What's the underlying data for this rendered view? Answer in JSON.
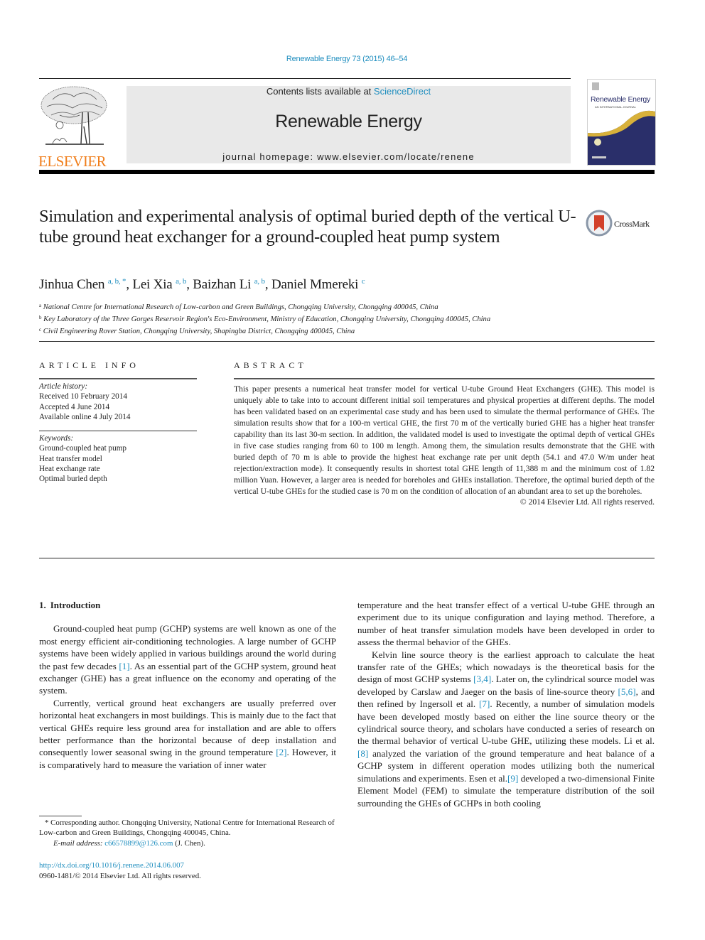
{
  "header": {
    "journal_ref": "Renewable Energy 73 (2015) 46–54",
    "publisher_word": "ELSEVIER",
    "contents_prefix": "Contents lists available at ",
    "contents_link": "ScienceDirect",
    "journal_title": "Renewable Energy",
    "homepage": "journal homepage: www.elsevier.com/locate/renene",
    "cover_title": "Renewable Energy",
    "cover_subtitle": "AN INTERNATIONAL JOURNAL",
    "colors": {
      "link": "#1f8ebf",
      "elsevier_orange": "#f07e1b",
      "cover_navy": "#2a2f6a",
      "cover_gold": "#d8b13a",
      "masthead_bg": "#e9e9e9"
    }
  },
  "crossmark": {
    "label": "CrossMark"
  },
  "article": {
    "title": "Simulation and experimental analysis of optimal buried depth of the vertical U-tube ground heat exchanger for a ground-coupled heat pump system",
    "authors": [
      {
        "name": "Jinhua Chen",
        "sup": "a, b, *"
      },
      {
        "name": "Lei Xia",
        "sup": "a, b"
      },
      {
        "name": "Baizhan Li",
        "sup": "a, b"
      },
      {
        "name": "Daniel Mmereki",
        "sup": "c"
      }
    ],
    "affiliations": [
      {
        "mark": "a",
        "text": "National Centre for International Research of Low-carbon and Green Buildings, Chongqing University, Chongqing 400045, China"
      },
      {
        "mark": "b",
        "text": "Key Laboratory of the Three Gorges Reservoir Region's Eco-Environment, Ministry of Education, Chongqing University, Chongqing 400045, China"
      },
      {
        "mark": "c",
        "text": "Civil Engineering Rover Station, Chongqing University, Shapingba District, Chongqing 400045, China"
      }
    ]
  },
  "article_info": {
    "heading": "ARTICLE INFO",
    "history_label": "Article history:",
    "history": [
      "Received 10 February 2014",
      "Accepted 4 June 2014",
      "Available online 4 July 2014"
    ],
    "keywords_label": "Keywords:",
    "keywords": [
      "Ground-coupled heat pump",
      "Heat transfer model",
      "Heat exchange rate",
      "Optimal buried depth"
    ]
  },
  "abstract": {
    "heading": "ABSTRACT",
    "text": "This paper presents a numerical heat transfer model for vertical U-tube Ground Heat Exchangers (GHE). This model is uniquely able to take into to account different initial soil temperatures and physical properties at different depths. The model has been validated based on an experimental case study and has been used to simulate the thermal performance of GHEs. The simulation results show that for a 100-m vertical GHE, the first 70 m of the vertically buried GHE has a higher heat transfer capability than its last 30-m section. In addition, the validated model is used to investigate the optimal depth of vertical GHEs in five case studies ranging from 60 to 100 m length. Among them, the simulation results demonstrate that the GHE with buried depth of 70 m is able to provide the highest heat exchange rate per unit depth (54.1 and 47.0 W/m under heat rejection/extraction mode). It consequently results in shortest total GHE length of 11,388 m and the minimum cost of 1.82 million Yuan. However, a larger area is needed for boreholes and GHEs installation. Therefore, the optimal buried depth of the vertical U-tube GHEs for the studied case is 70 m on the condition of allocation of an abundant area to set up the boreholes.",
    "copyright": "© 2014 Elsevier Ltd. All rights reserved."
  },
  "body": {
    "section_number": "1.",
    "section_title": "Introduction",
    "left": {
      "p1_a": "Ground-coupled heat pump (GCHP) systems are well known as one of the most energy efficient air-conditioning technologies. A large number of GCHP systems have been widely applied in various buildings around the world during the past few decades ",
      "p1_ref": "[1]",
      "p1_b": ". As an essential part of the GCHP system, ground heat exchanger (GHE) has a great influence on the economy and operating of the system.",
      "p2_a": "Currently, vertical ground heat exchangers are usually preferred over horizontal heat exchangers in most buildings. This is mainly due to the fact that vertical GHEs require less ground area for installation and are able to offers better performance than the horizontal because of deep installation and consequently lower seasonal swing in the ground temperature ",
      "p2_ref": "[2]",
      "p2_b": ". However, it is comparatively hard to measure the variation of inner water"
    },
    "right": {
      "p0": "temperature and the heat transfer effect of a vertical U-tube GHE through an experiment due to its unique configuration and laying method. Therefore, a number of heat transfer simulation models have been developed in order to assess the thermal behavior of the GHEs.",
      "p1_a": "Kelvin line source theory is the earliest approach to calculate the heat transfer rate of the GHEs; which nowadays is the theoretical basis for the design of most GCHP systems ",
      "p1_ref1": "[3,4]",
      "p1_b": ". Later on, the cylindrical source model was developed by Carslaw and Jaeger on the basis of line-source theory ",
      "p1_ref2": "[5,6]",
      "p1_c": ", and then refined by Ingersoll et al. ",
      "p1_ref3": "[7]",
      "p1_d": ". Recently, a number of simulation models have been developed mostly based on either the line source theory or the cylindrical source theory, and scholars have conducted a series of research on the thermal behavior of vertical U-tube GHE, utilizing these models. Li et al. ",
      "p1_ref4": "[8]",
      "p1_e": " analyzed the variation of the ground temperature and heat balance of a GCHP system in different operation modes utilizing both the numerical simulations and experiments. Esen et al.",
      "p1_ref5": "[9]",
      "p1_f": " developed a two-dimensional Finite Element Model (FEM) to simulate the temperature distribution of the soil surrounding the GHEs of GCHPs in both cooling"
    }
  },
  "footnotes": {
    "corresponding": "* Corresponding author. Chongqing University, National Centre for International Research of Low-carbon and Green Buildings, Chongqing 400045, China.",
    "email_label": "E-mail address: ",
    "email": "c66578899@126.com",
    "email_suffix": " (J. Chen).",
    "doi": "http://dx.doi.org/10.1016/j.renene.2014.06.007",
    "issn": "0960-1481/© 2014 Elsevier Ltd. All rights reserved."
  }
}
